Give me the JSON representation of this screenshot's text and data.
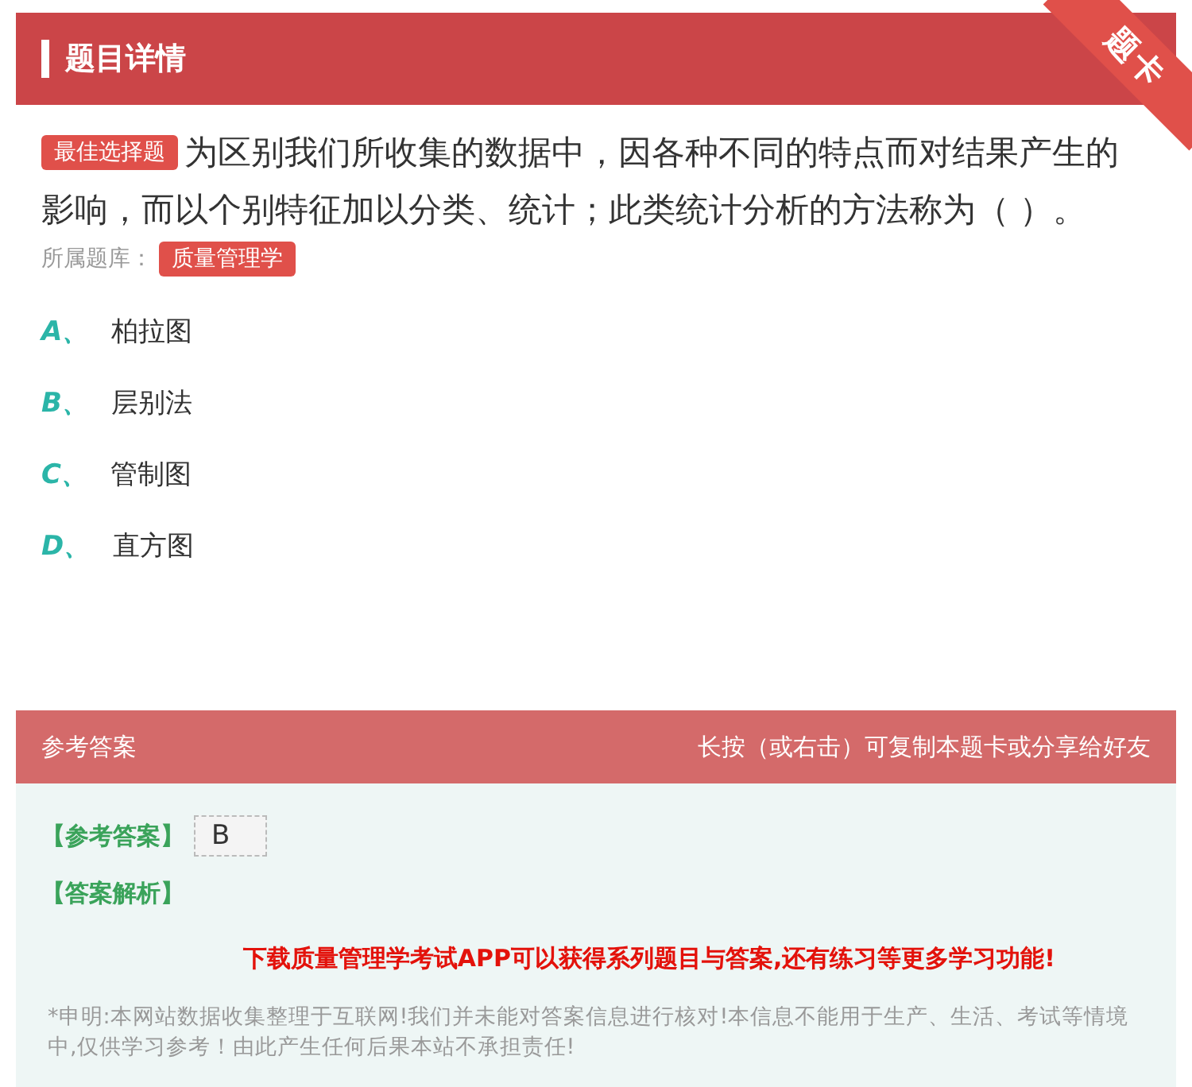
{
  "header": {
    "title": "题目详情",
    "corner_ribbon": "题卡"
  },
  "question": {
    "type_badge": "最佳选择题",
    "text": "为区别我们所收集的数据中，因各种不同的特点而对结果产生的影响，而以个别特征加以分类、统计；此类统计分析的方法称为（ ）。",
    "bank_label": "所属题库：",
    "bank": "质量管理学"
  },
  "options": [
    {
      "letter": "A、",
      "text": "柏拉图"
    },
    {
      "letter": "B、",
      "text": "层别法"
    },
    {
      "letter": "C、",
      "text": "管制图"
    },
    {
      "letter": "D、",
      "text": "直方图"
    }
  ],
  "answer_panel": {
    "title": "参考答案",
    "hint": "长按（或右击）可复制本题卡或分享给好友",
    "answer_label": "【参考答案】",
    "answer": "B",
    "analysis_label": "【答案解析】",
    "promo": "下载质量管理学考试APP可以获得系列题目与答案,还有练习等更多学习功能!",
    "disclaimer": "*申明:本网站数据收集整理于互联网!我们并未能对答案信息进行核对!本信息不能用于生产、生活、考试等情境中,仅供学习参考！由此产生任何后果本站不承担责任!"
  }
}
